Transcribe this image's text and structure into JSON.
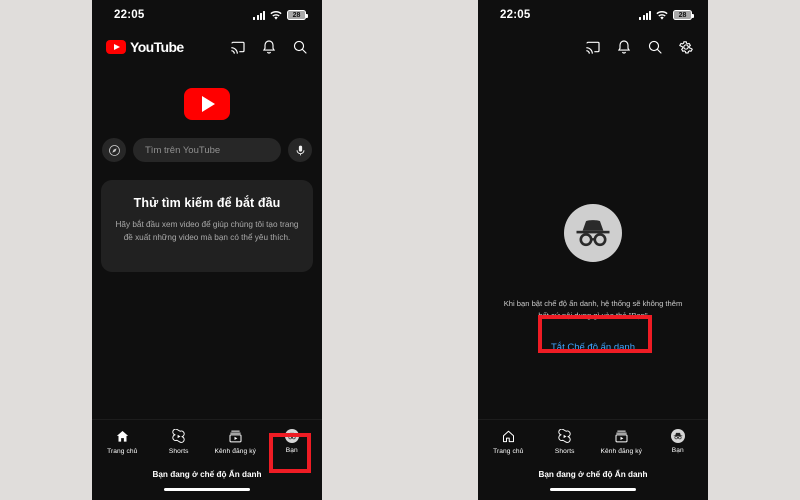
{
  "background_color": "#e0dddb",
  "accent_colors": {
    "youtube_red": "#ff0000",
    "link_blue": "#3ea6ff",
    "annotation_red": "#ee1c24",
    "phone_bg": "#0f0f0f",
    "card_bg": "#212121"
  },
  "left_phone": {
    "status_bar": {
      "clock": "22:05",
      "signal_icon": "cellular-signal-icon",
      "wifi_icon": "wifi-icon",
      "battery_icon": "battery-icon",
      "battery_level": "28"
    },
    "app_bar": {
      "logo_text": "YouTube",
      "logo_icon": "youtube-logo-icon",
      "actions": [
        {
          "icon": "cast-icon",
          "name": "cast-button"
        },
        {
          "icon": "bell-icon",
          "name": "notifications-button"
        },
        {
          "icon": "search-icon",
          "name": "search-button"
        }
      ]
    },
    "hero_logo_icon": "youtube-play-logo-icon",
    "search": {
      "explore_icon": "compass-explore-icon",
      "placeholder": "Tìm trên YouTube",
      "value": "",
      "mic_icon": "microphone-icon"
    },
    "hint_card": {
      "title": "Thử tìm kiếm để bắt đầu",
      "body": "Hãy bắt đầu xem video để giúp chúng tôi tạo trang đề xuất những video mà bạn có thể yêu thích."
    },
    "bottom_nav": {
      "items": [
        {
          "label": "Trang chủ",
          "icon": "home-icon",
          "active": true
        },
        {
          "label": "Shorts",
          "icon": "shorts-icon",
          "active": false
        },
        {
          "label": "Kênh đăng ký",
          "icon": "subscriptions-icon",
          "active": false
        },
        {
          "label": "Bạn",
          "icon": "incognito-avatar-icon",
          "active": false
        }
      ]
    },
    "incognito_status": "Bạn đang ở chế độ Ẩn danh"
  },
  "right_phone": {
    "status_bar": {
      "clock": "22:05",
      "signal_icon": "cellular-signal-icon",
      "wifi_icon": "wifi-icon",
      "battery_icon": "battery-icon",
      "battery_level": "28"
    },
    "app_bar": {
      "actions": [
        {
          "icon": "cast-icon",
          "name": "cast-button"
        },
        {
          "icon": "bell-icon",
          "name": "notifications-button"
        },
        {
          "icon": "search-icon",
          "name": "search-button"
        },
        {
          "icon": "gear-icon",
          "name": "settings-button"
        }
      ]
    },
    "incognito_icon": "incognito-hat-glasses-icon",
    "incognito_message": "Khi bạn bật chế độ ẩn danh, hệ thống sẽ không thêm bất cứ nội dung gì vào thẻ \"Bạn\"",
    "turn_off_button": "Tắt Chế độ ẩn danh",
    "bottom_nav": {
      "items": [
        {
          "label": "Trang chủ",
          "icon": "home-icon",
          "active": false
        },
        {
          "label": "Shorts",
          "icon": "shorts-icon",
          "active": false
        },
        {
          "label": "Kênh đăng ký",
          "icon": "subscriptions-icon",
          "active": false
        },
        {
          "label": "Bạn",
          "icon": "incognito-avatar-icon",
          "active": true
        }
      ]
    },
    "incognito_status": "Bạn đang ở chế độ Ẩn danh"
  },
  "annotations": [
    {
      "name": "redbox-ban-tab",
      "target": "left phone bottom nav Bạn tab"
    },
    {
      "name": "redbox-turnoff",
      "target": "right phone Tắt Chế độ ẩn danh button"
    }
  ]
}
